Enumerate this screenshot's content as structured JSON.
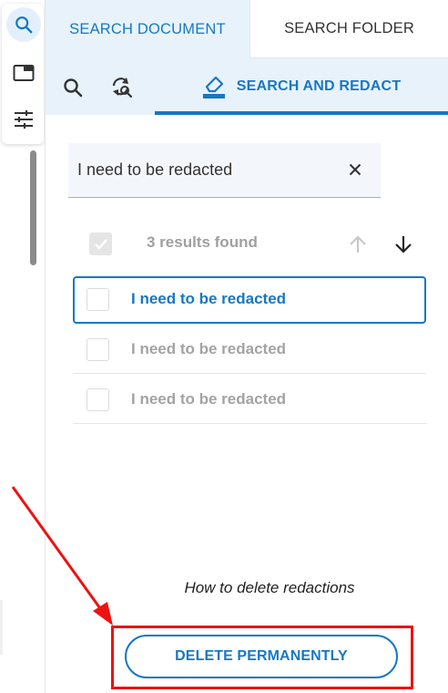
{
  "rail": {
    "items": [
      {
        "icon": "search-icon",
        "active": true
      },
      {
        "icon": "window-icon",
        "active": false
      },
      {
        "icon": "sliders-icon",
        "active": false
      }
    ]
  },
  "tabs": {
    "document": "SEARCH DOCUMENT",
    "folder": "SEARCH FOLDER"
  },
  "toolbar": {
    "redact_label": "SEARCH AND REDACT"
  },
  "search": {
    "value": "I need to be redacted"
  },
  "results": {
    "count_text": "3 results found",
    "items": [
      {
        "label": "I need to be redacted",
        "active": true
      },
      {
        "label": "I need to be redacted",
        "active": false
      },
      {
        "label": "I need to be redacted",
        "active": false
      }
    ]
  },
  "footer": {
    "howto": "How to delete redactions",
    "delete_label": "DELETE PERMANENTLY"
  },
  "colors": {
    "accent": "#1678c2",
    "annotation": "#ee1111"
  }
}
